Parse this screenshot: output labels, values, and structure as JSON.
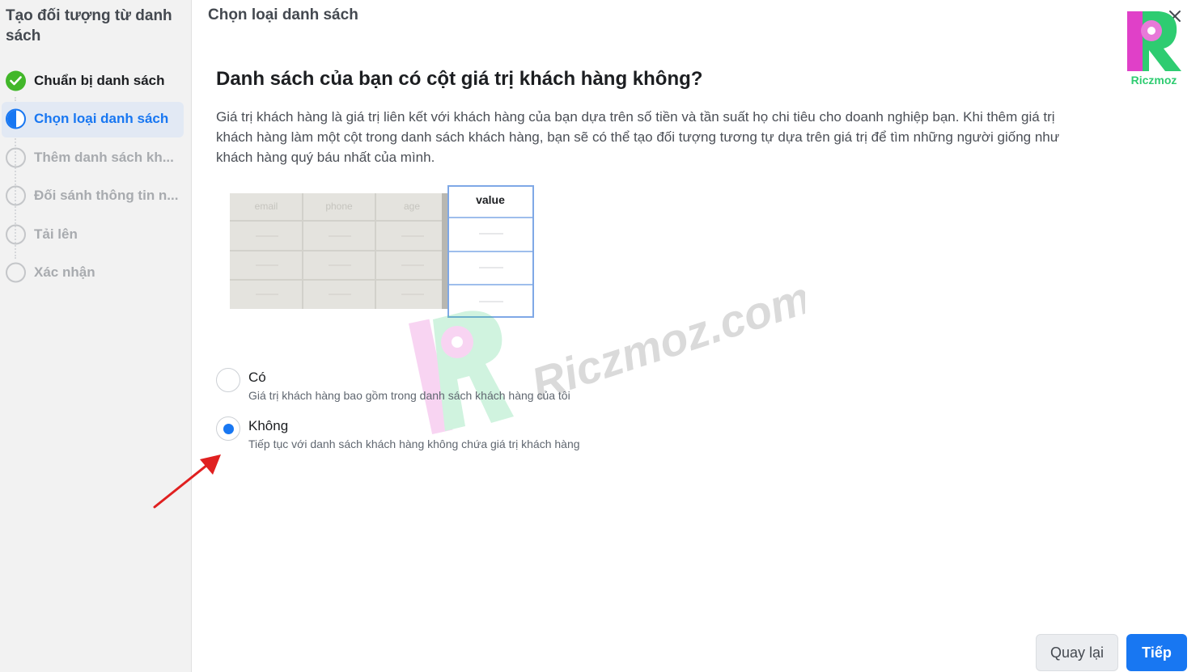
{
  "sidebar": {
    "title": "Tạo đối tượng từ danh sách",
    "steps": [
      {
        "label": "Chuẩn bị danh sách",
        "status": "done"
      },
      {
        "label": "Chọn loại danh sách",
        "status": "active"
      },
      {
        "label": "Thêm danh sách kh...",
        "status": "todo"
      },
      {
        "label": "Đối sánh thông tin n...",
        "status": "todo"
      },
      {
        "label": "Tải lên",
        "status": "todo"
      },
      {
        "label": "Xác nhận",
        "status": "todo"
      }
    ]
  },
  "header": {
    "title": "Chọn loại danh sách",
    "close_icon": "close-icon"
  },
  "logo": {
    "text": "Riczmoz"
  },
  "main": {
    "question": "Danh sách của bạn có cột giá trị khách hàng không?",
    "description": "Giá trị khách hàng là giá trị liên kết với khách hàng của bạn dựa trên số tiền và tần suất họ chi tiêu cho doanh nghiệp bạn. Khi thêm giá trị khách hàng làm một cột trong danh sách khách hàng, bạn sẽ có thể tạo đối tượng tương tự dựa trên giá trị để tìm những người giống như khách hàng quý báu nhất của mình.",
    "illustration": {
      "columns": [
        "email",
        "phone",
        "age"
      ],
      "highlight_column": "value"
    },
    "options": [
      {
        "label": "Có",
        "sublabel": "Giá trị khách hàng bao gồm trong danh sách khách hàng của tôi",
        "checked": false
      },
      {
        "label": "Không",
        "sublabel": "Tiếp tục với danh sách khách hàng không chứa giá trị khách hàng",
        "checked": true
      }
    ]
  },
  "watermark": {
    "text": "Riczmoz.com"
  },
  "footer": {
    "back_label": "Quay lại",
    "next_label": "Tiếp"
  },
  "colors": {
    "accent": "#1877f2",
    "success": "#42b72a",
    "arrow": "#e02020"
  }
}
